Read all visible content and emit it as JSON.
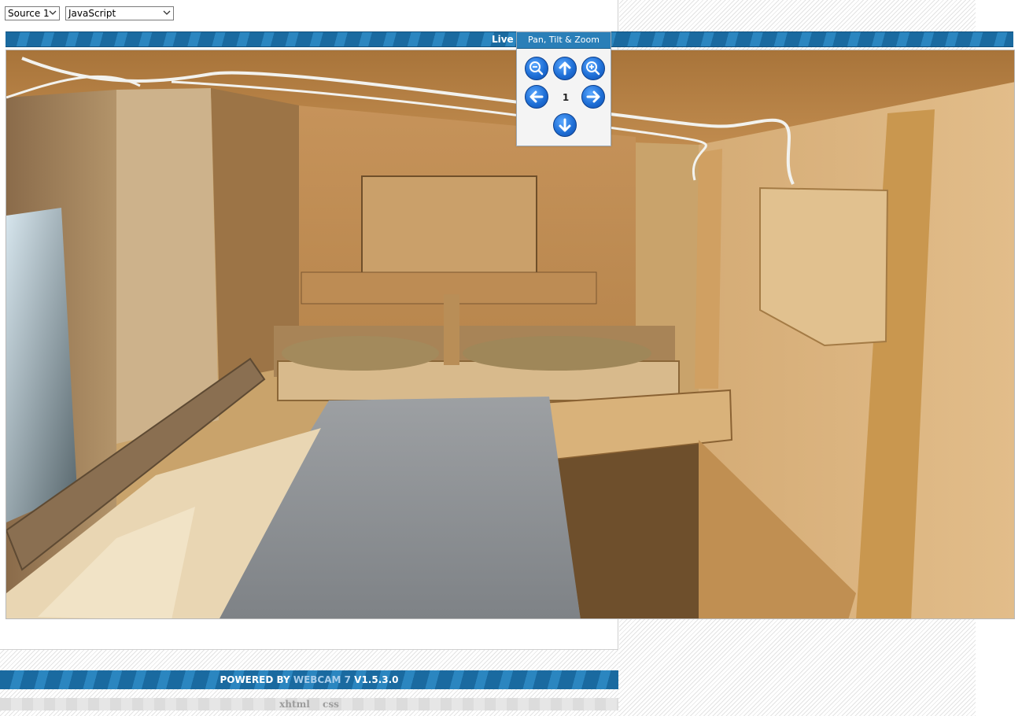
{
  "controls": {
    "source_value": "Source 1",
    "renderer_value": "JavaScript"
  },
  "title_bar": {
    "label": "Live Vi"
  },
  "ptz": {
    "title": "Pan, Tilt & Zoom",
    "zoom_level": "1",
    "buttons": {
      "zoom_out": "zoom-out-icon",
      "up": "arrow-up-icon",
      "zoom_in": "zoom-in-icon",
      "left": "arrow-left-icon",
      "right": "arrow-right-icon",
      "down": "arrow-down-icon"
    }
  },
  "footer": {
    "powered_by": "POWERED BY",
    "brand": "WEBCAM 7",
    "version": "V1.5.3.0",
    "link_xhtml": "xhtml",
    "link_css": "css"
  },
  "colors": {
    "accent": "#1a6aa0",
    "ptz_button": "#1f6fd6"
  }
}
